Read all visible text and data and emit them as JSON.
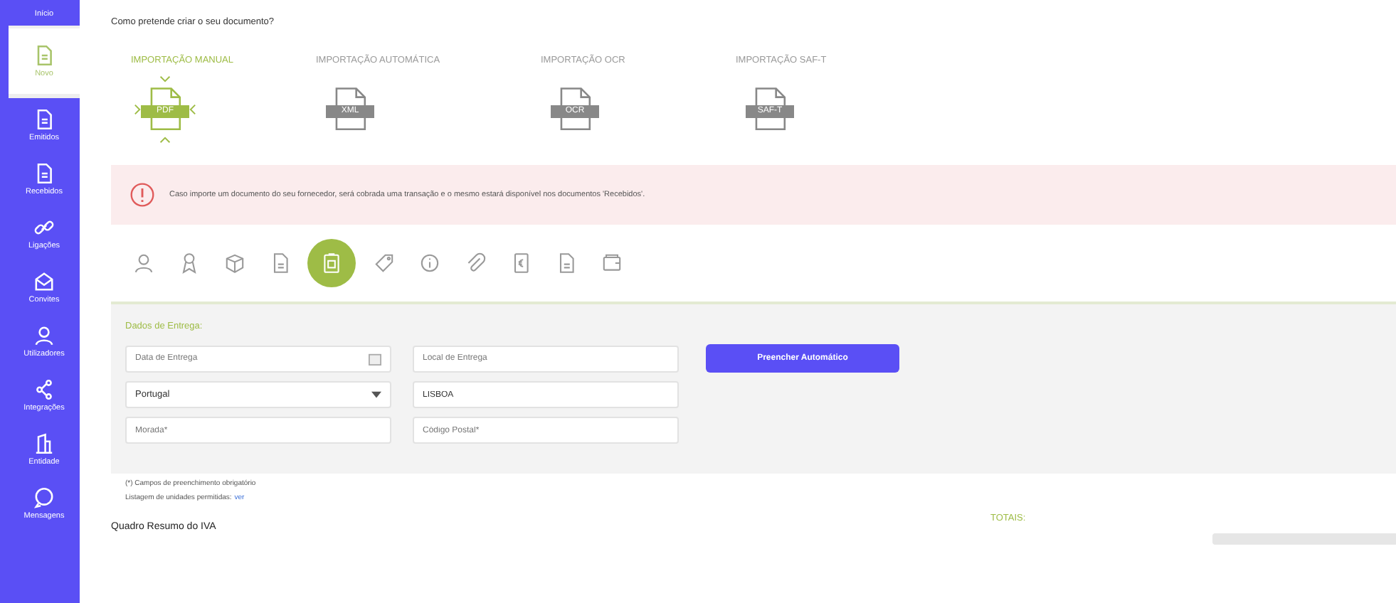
{
  "sidebar": {
    "items": [
      {
        "label": "Início",
        "kind": "plain",
        "selected": false
      },
      {
        "label": "Novo",
        "kind": "doc",
        "selected": true
      },
      {
        "label": "Emitidos",
        "kind": "doc",
        "selected": false
      },
      {
        "label": "Recebidos",
        "kind": "doc",
        "selected": false
      },
      {
        "label": "Ligações",
        "kind": "link",
        "selected": false
      },
      {
        "label": "Convites",
        "kind": "envelope",
        "selected": false
      },
      {
        "label": "Utilizadores",
        "kind": "user",
        "selected": false
      },
      {
        "label": "Integrações",
        "kind": "share",
        "selected": false
      },
      {
        "label": "Entidade",
        "kind": "building",
        "selected": false
      },
      {
        "label": "Mensagens",
        "kind": "chat",
        "selected": false
      }
    ]
  },
  "question": "Como pretende criar o seu documento?",
  "import_options": [
    {
      "label": "IMPORTAÇÃO MANUAL",
      "badge": "PDF",
      "selected": true
    },
    {
      "label": "IMPORTAÇÃO AUTOMÁTICA",
      "badge": "XML",
      "selected": false
    },
    {
      "label": "IMPORTAÇÃO OCR",
      "badge": "OCR",
      "selected": false
    },
    {
      "label": "IMPORTAÇÃO SAF-T",
      "badge": "SAF-T",
      "selected": false
    }
  ],
  "alert": {
    "text": "Caso importe um documento do seu fornecedor, será cobrada uma transação e o mesmo estará disponível nos documentos 'Recebidos'."
  },
  "steps": [
    {
      "kind": "person",
      "selected": false
    },
    {
      "kind": "badge",
      "selected": false
    },
    {
      "kind": "box",
      "selected": false
    },
    {
      "kind": "doc",
      "selected": false
    },
    {
      "kind": "clipboard",
      "selected": true
    },
    {
      "kind": "tag",
      "selected": false
    },
    {
      "kind": "info",
      "selected": false
    },
    {
      "kind": "clip",
      "selected": false
    },
    {
      "kind": "euro",
      "selected": false
    },
    {
      "kind": "doc",
      "selected": false
    },
    {
      "kind": "wallet",
      "selected": false
    }
  ],
  "delivery": {
    "title": "Dados de Entrega:",
    "fields": [
      {
        "kind": "date",
        "placeholder": "Data de Entrega"
      },
      {
        "kind": "text",
        "placeholder": "Local de Entrega"
      },
      {
        "kind": "select",
        "value": "Portugal"
      },
      {
        "kind": "text",
        "value": "LISBOA"
      },
      {
        "kind": "text",
        "placeholder": "Morada*"
      },
      {
        "kind": "text",
        "placeholder": "Código Postal*"
      }
    ],
    "button": "Preencher Automático"
  },
  "notes": {
    "required": "(*) Campos de preenchimento obrigatório",
    "units": "Listagem de unidades permitidas:",
    "units_link": "ver"
  },
  "vat_title": "Quadro Resumo do IVA",
  "totals_label": "TOTAIS:"
}
